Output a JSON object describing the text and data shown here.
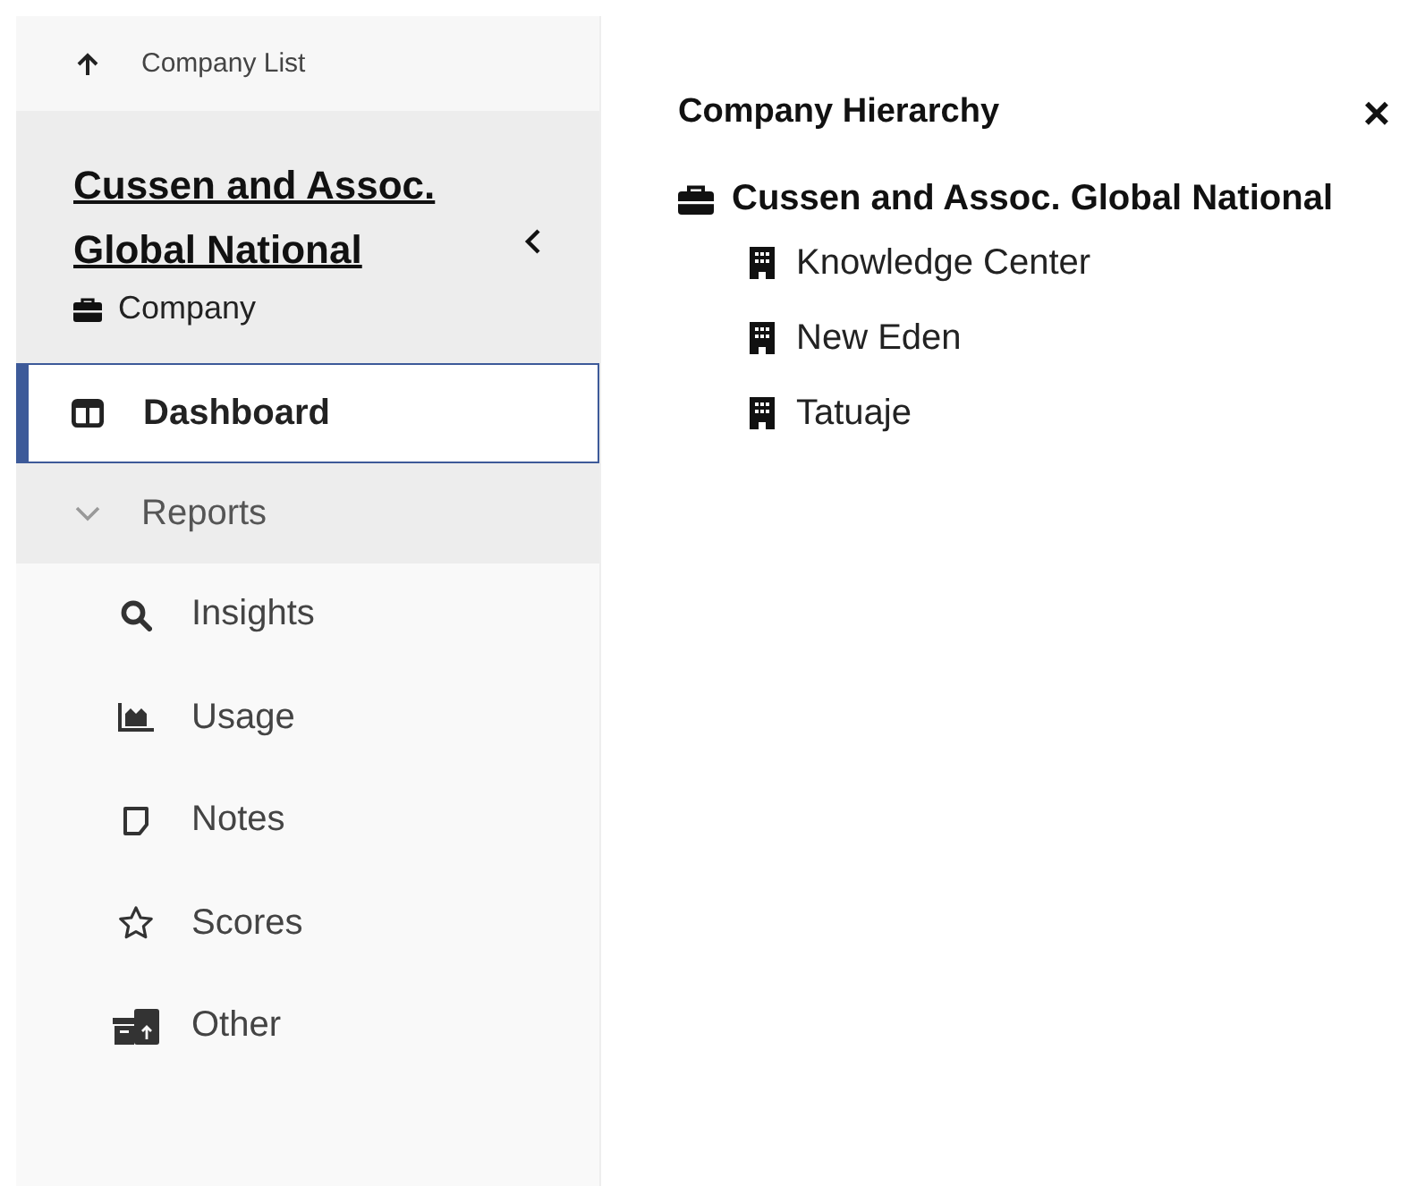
{
  "back_link": {
    "label": "Company List"
  },
  "company": {
    "name": "Cussen and Assoc. Global National",
    "type": "Company"
  },
  "nav": [
    {
      "kind": "item",
      "label": "Dashboard",
      "selected": true
    },
    {
      "kind": "group",
      "label": "Reports",
      "selected": false,
      "expanded": true,
      "children": [
        {
          "label": "Insights",
          "selected": false
        },
        {
          "label": "Usage",
          "selected": false
        },
        {
          "label": "Notes",
          "selected": false
        },
        {
          "label": "Scores",
          "selected": false
        },
        {
          "label": "Other",
          "selected": false
        }
      ]
    }
  ],
  "hierarchy": {
    "title": "Company Hierarchy",
    "close": "×",
    "root": {
      "label": "Cussen and Assoc. Global National",
      "children": [
        {
          "label": "Knowledge Center"
        },
        {
          "label": "New Eden"
        },
        {
          "label": "Tatuaje"
        }
      ]
    }
  }
}
